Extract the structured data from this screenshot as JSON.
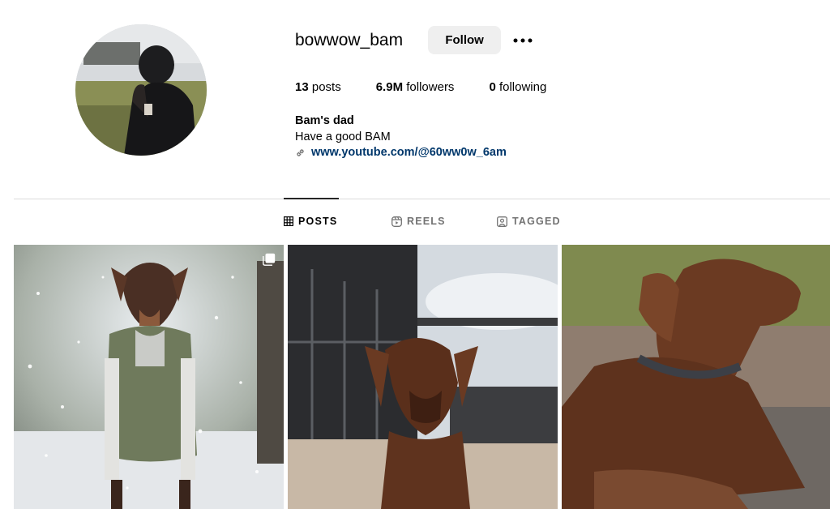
{
  "profile": {
    "username": "bowwow_bam",
    "follow_label": "Follow",
    "more_icon": "more-horizontal-icon"
  },
  "stats": {
    "posts_count": "13",
    "posts_label": "posts",
    "followers_count": "6.9M",
    "followers_label": "followers",
    "following_count": "0",
    "following_label": "following"
  },
  "bio": {
    "name": "Bam's dad",
    "text": "Have a good BAM",
    "link": "www.youtube.com/@60ww0w_6am",
    "link_icon": "link-icon"
  },
  "tabs": [
    {
      "label": "POSTS",
      "icon": "grid-icon",
      "active": true
    },
    {
      "label": "REELS",
      "icon": "reels-icon",
      "active": false
    },
    {
      "label": "TAGGED",
      "icon": "tagged-icon",
      "active": false
    }
  ],
  "posts": [
    {
      "subject": "doberman in green vest in snow",
      "multi_photo": true
    },
    {
      "subject": "doberman on terrace",
      "multi_photo": false
    },
    {
      "subject": "doberman lying with collar",
      "multi_photo": false
    }
  ],
  "colors": {
    "link": "#00376b",
    "follow_bg": "#efefef",
    "divider": "#dbdbdb",
    "inactive_tab": "#737373"
  }
}
